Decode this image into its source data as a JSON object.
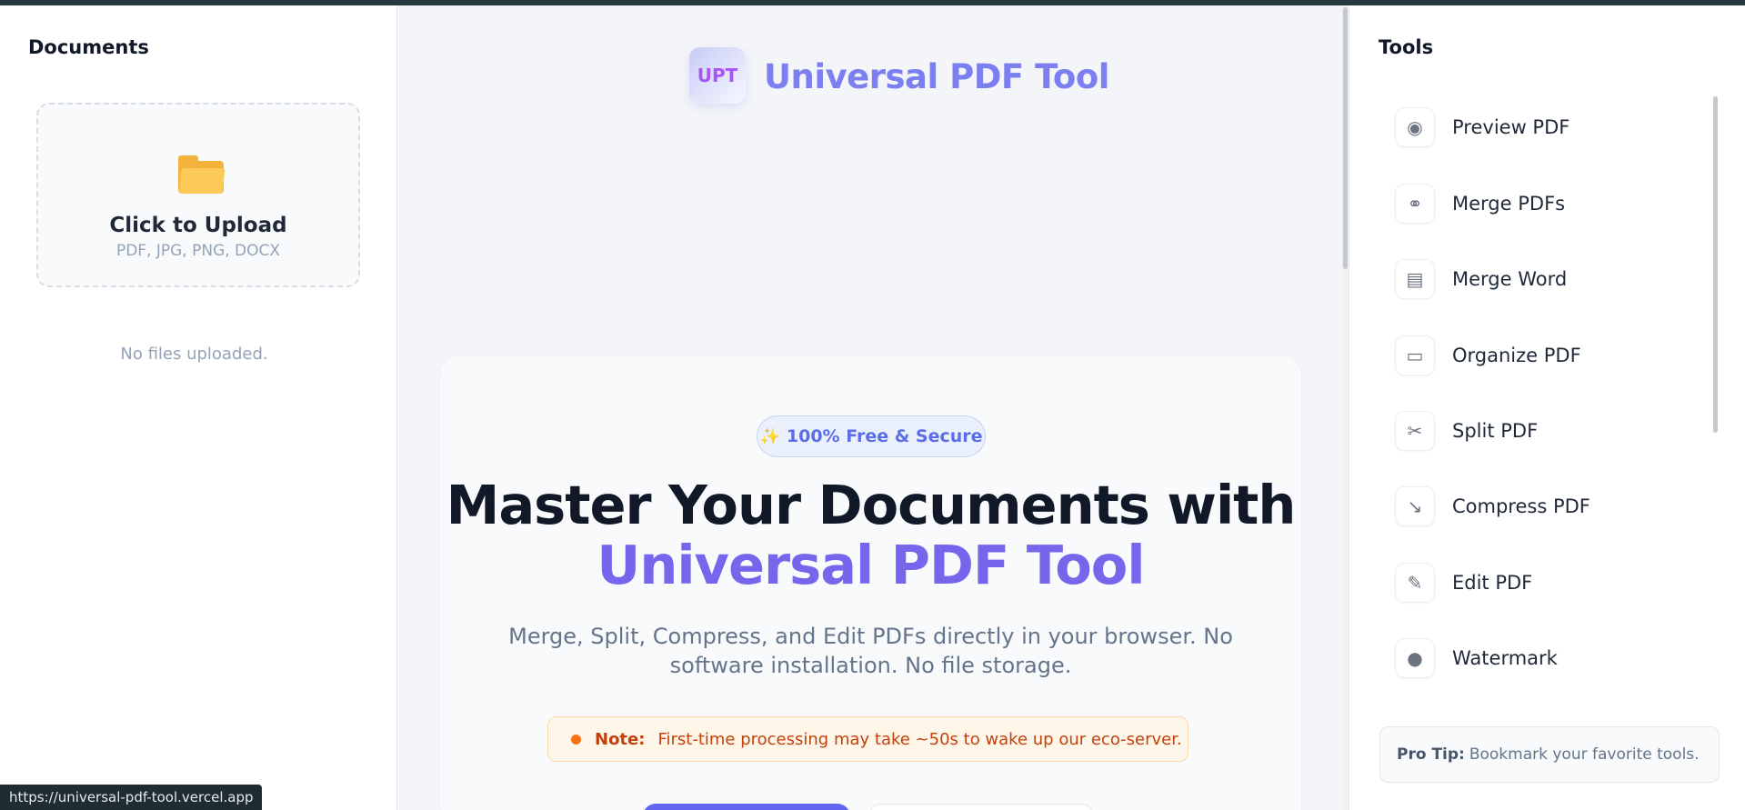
{
  "left_panel": {
    "title": "Documents",
    "upload": {
      "title": "Click to Upload",
      "formats": "PDF, JPG, PNG, DOCX",
      "icon": "folder-icon"
    },
    "empty_text": "No files uploaded."
  },
  "header": {
    "logo_text": "UPT",
    "app_name": "Universal PDF Tool"
  },
  "hero": {
    "badge_icon": "✨",
    "badge_text": "100% Free & Secure",
    "headline_line1": "Master Your Documents with",
    "headline_line2": "Universal PDF Tool",
    "subtitle": "Merge, Split, Compress, and Edit PDFs directly in your browser. No software installation. No file storage.",
    "note_label": "Note:",
    "note_text": "First-time processing may take ~50s to wake up our eco-server."
  },
  "tools_panel": {
    "title": "Tools",
    "items": [
      {
        "label": "Preview PDF",
        "icon": "eye-icon",
        "glyph": "◉"
      },
      {
        "label": "Merge PDFs",
        "icon": "link-icon",
        "glyph": "⚭"
      },
      {
        "label": "Merge Word",
        "icon": "document-icon",
        "glyph": "▤"
      },
      {
        "label": "Organize PDF",
        "icon": "file-folder-icon",
        "glyph": "▭"
      },
      {
        "label": "Split PDF",
        "icon": "scissors-icon",
        "glyph": "✂"
      },
      {
        "label": "Compress PDF",
        "icon": "chart-down-icon",
        "glyph": "↘"
      },
      {
        "label": "Edit PDF",
        "icon": "pencil-icon",
        "glyph": "✎"
      },
      {
        "label": "Watermark",
        "icon": "droplet-icon",
        "glyph": "●"
      }
    ],
    "pro_tip_label": "Pro Tip:",
    "pro_tip_text": "Bookmark your favorite tools."
  },
  "status_bar": {
    "url": "https://universal-pdf-tool.vercel.app"
  },
  "colors": {
    "brand": "#7c7ff0",
    "accent": "#6366f1",
    "headline_gradient": "#7566ec",
    "note": "#c2410c"
  }
}
